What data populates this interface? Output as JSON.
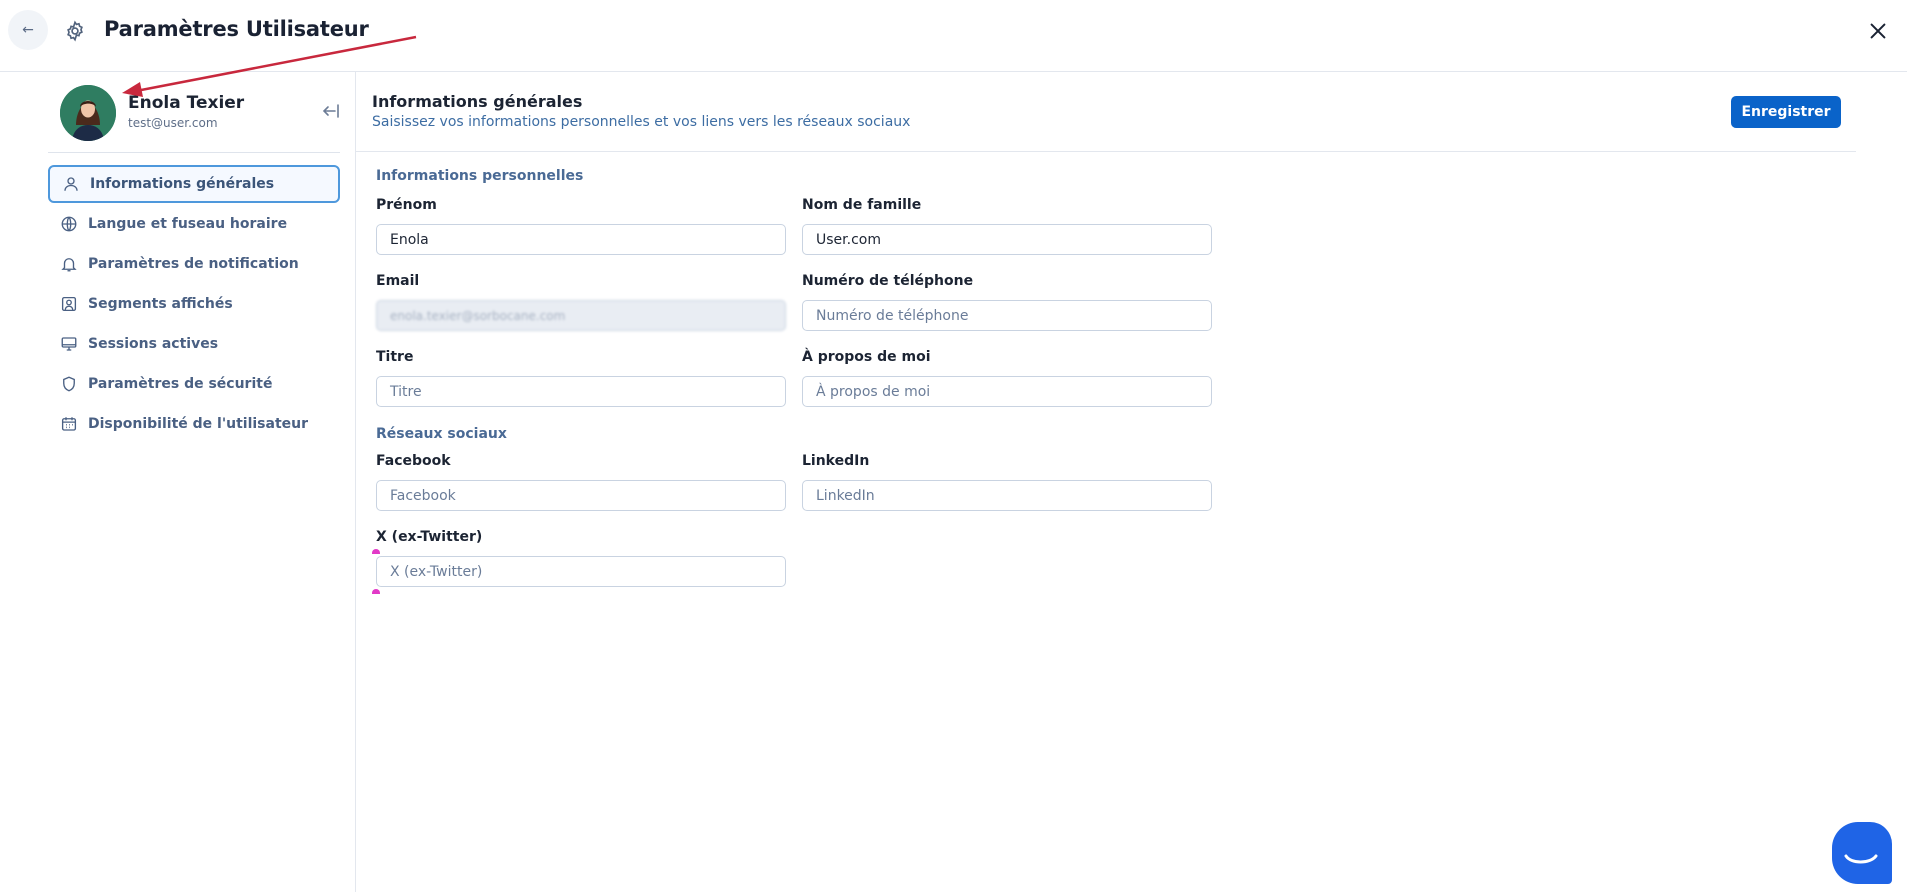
{
  "header": {
    "back_icon": "arrow-left-icon",
    "settings_icon": "gear-icon",
    "title": "Paramètres Utilisateur",
    "close_icon": "close-icon"
  },
  "user": {
    "name": "Enola Texier",
    "email": "test@user.com"
  },
  "sidebar": {
    "items": [
      {
        "label": "Informations générales",
        "icon": "user-icon",
        "active": true
      },
      {
        "label": "Langue et fuseau horaire",
        "icon": "globe-icon",
        "active": false
      },
      {
        "label": "Paramètres de notification",
        "icon": "bell-icon",
        "active": false
      },
      {
        "label": "Segments affichés",
        "icon": "user-square-icon",
        "active": false
      },
      {
        "label": "Sessions actives",
        "icon": "monitor-icon",
        "active": false
      },
      {
        "label": "Paramètres de sécurité",
        "icon": "shield-icon",
        "active": false
      },
      {
        "label": "Disponibilité de l'utilisateur",
        "icon": "calendar-icon",
        "active": false
      }
    ]
  },
  "main": {
    "title": "Informations générales",
    "subtitle": "Saisissez vos informations personnelles et vos liens vers les réseaux sociaux",
    "save_label": "Enregistrer",
    "personal_section": "Informations personnelles",
    "social_section": "Réseaux sociaux",
    "fields": {
      "first_name": {
        "label": "Prénom",
        "value": "Enola"
      },
      "last_name": {
        "label": "Nom de famille",
        "value": "User.com"
      },
      "email": {
        "label": "Email",
        "value": "enola.texier@sorbocane.com"
      },
      "phone": {
        "label": "Numéro de téléphone",
        "placeholder": "Numéro de téléphone"
      },
      "title": {
        "label": "Titre",
        "placeholder": "Titre"
      },
      "about": {
        "label": "À propos de moi",
        "placeholder": "À propos de moi"
      },
      "facebook": {
        "label": "Facebook",
        "placeholder": "Facebook"
      },
      "linkedin": {
        "label": "LinkedIn",
        "placeholder": "LinkedIn"
      },
      "twitter": {
        "label": "X (ex-Twitter)",
        "placeholder": "X (ex-Twitter)"
      }
    }
  },
  "colors": {
    "accent": "#0a63c9",
    "annotation_arrow": "#c8283d",
    "chat_bubble": "#1f64e6"
  }
}
